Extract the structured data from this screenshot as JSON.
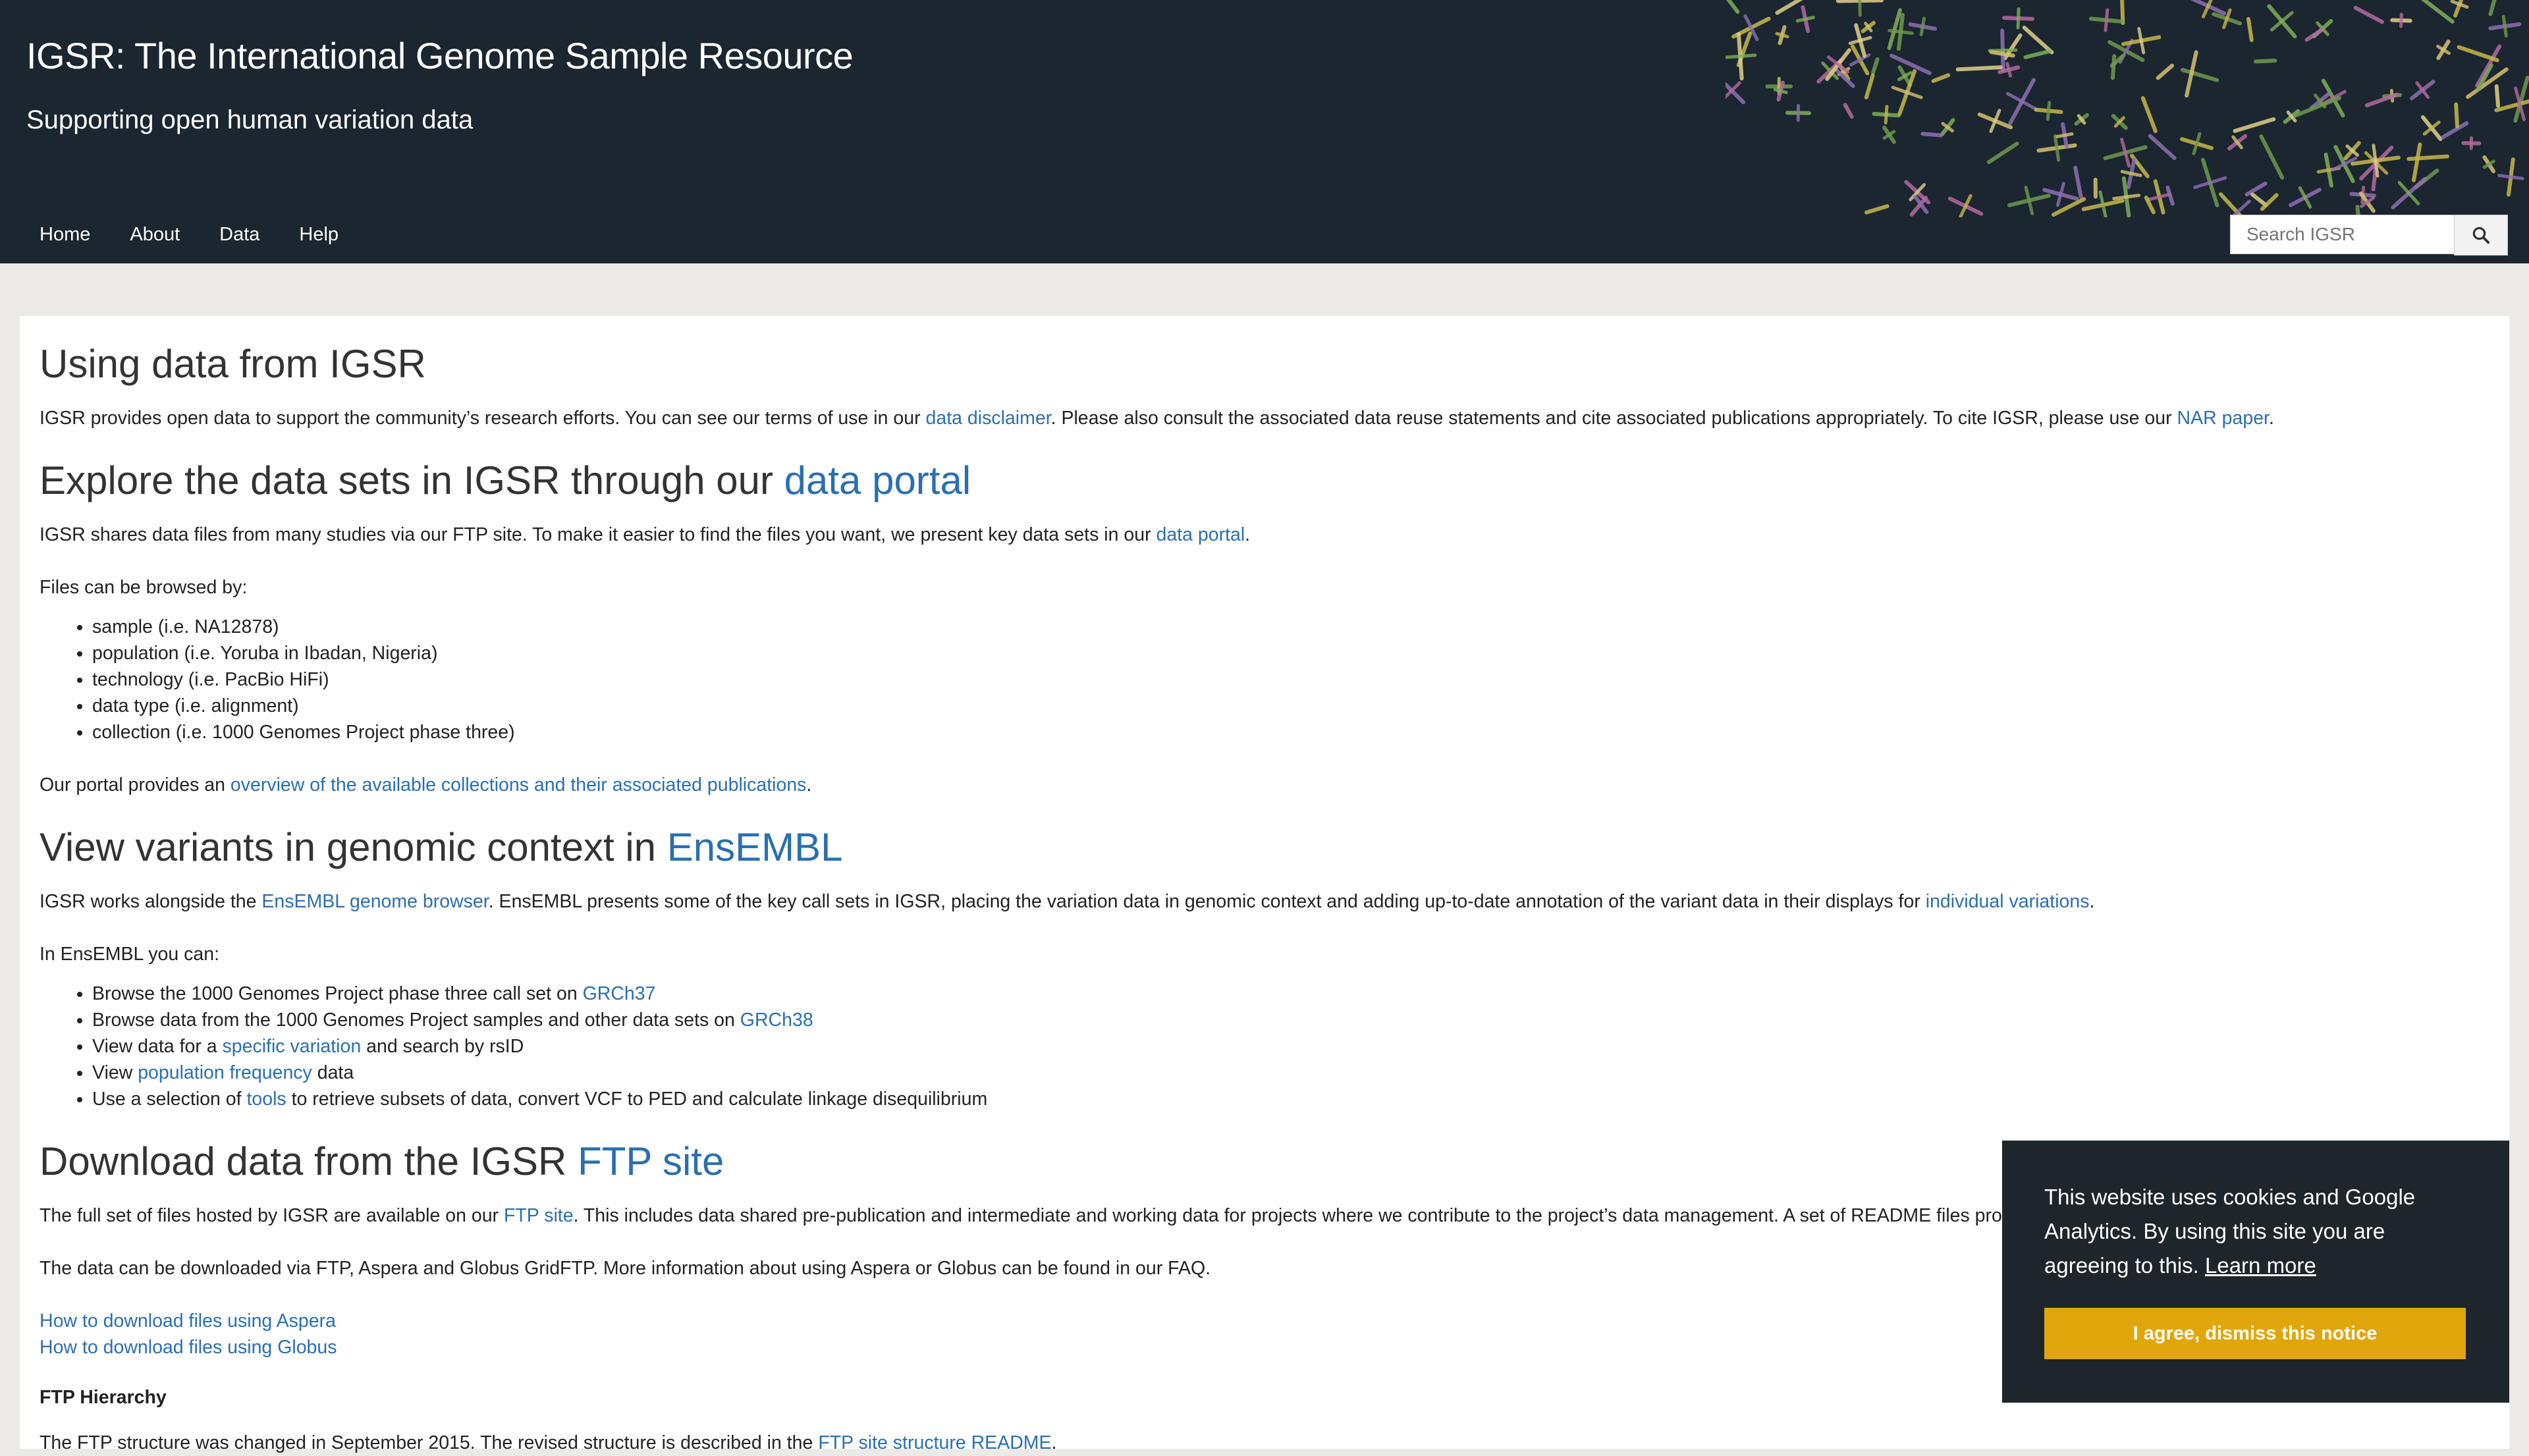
{
  "header": {
    "title": "IGSR: The International Genome Sample Resource",
    "subtitle": "Supporting open human variation data",
    "nav": [
      "Home",
      "About",
      "Data",
      "Help"
    ],
    "search_placeholder": "Search IGSR",
    "bg_color": "#1b2630"
  },
  "intro": {
    "title": "Using data from IGSR",
    "p1_a": "IGSR provides open data to support the community’s research efforts. You can see our terms of use in our ",
    "p1_link1": "data disclaimer",
    "p1_b": ". Please also consult the associated data reuse statements and cite associated publications appropriately. To cite IGSR, please use our ",
    "p1_link2": "NAR paper",
    "p1_c": "."
  },
  "explore": {
    "heading_a": "Explore the data sets in IGSR through our ",
    "heading_link": "data portal",
    "p1_a": "IGSR shares data files from many studies via our FTP site. To make it easier to find the files you want, we present key data sets in our ",
    "p1_link": "data portal",
    "p1_b": ".",
    "p2": "Files can be browsed by:",
    "list": [
      "sample (i.e. NA12878)",
      "population (i.e. Yoruba in Ibadan, Nigeria)",
      "technology (i.e. PacBio HiFi)",
      "data type (i.e. alignment)",
      "collection (i.e. 1000 Genomes Project phase three)"
    ],
    "p3_a": "Our portal provides an ",
    "p3_link": "overview of the available collections and their associated publications",
    "p3_b": "."
  },
  "ensembl": {
    "heading_a": "View variants in genomic context in ",
    "heading_link": "EnsEMBL",
    "p1_a": "IGSR works alongside the ",
    "p1_link1": "EnsEMBL genome browser",
    "p1_b": ". EnsEMBL presents some of the key call sets in IGSR, placing the variation data in genomic context and adding up-to-date annotation of the variant data in their displays for ",
    "p1_link2": "individual variations",
    "p1_c": ".",
    "p2": "In EnsEMBL you can:",
    "li1_a": "Browse the 1000 Genomes Project phase three call set on ",
    "li1_link": "GRCh37",
    "li2_a": "Browse data from the 1000 Genomes Project samples and other data sets on ",
    "li2_link": "GRCh38",
    "li3_a": "View data for a ",
    "li3_link": "specific variation",
    "li3_b": " and search by rsID",
    "li4_a": "View ",
    "li4_link": "population frequency",
    "li4_b": " data",
    "li5_a": "Use a selection of ",
    "li5_link": "tools",
    "li5_b": " to retrieve subsets of data, convert VCF to PED and calculate linkage disequilibrium"
  },
  "download": {
    "heading_a": "Download data from the IGSR ",
    "heading_link": "FTP site",
    "p1_a": "The full set of files hosted by IGSR are available on our ",
    "p1_link": "FTP site",
    "p1_b": ". This includes data shared pre-publication and intermediate and working data for projects where we contribute to the project’s data management. A set of README files provi",
    "p2": "The data can be downloaded via FTP, Aspera and Globus GridFTP. More information about using Aspera or Globus can be found in our FAQ.",
    "link_aspera": "How to download files using Aspera",
    "link_globus": "How to download files using Globus",
    "ftp_heading": "FTP Hierarchy",
    "p3_a": "The FTP structure was changed in September 2015. The revised structure is described in the ",
    "p3_link": "FTP site structure README",
    "p3_b": "."
  },
  "cookie": {
    "text": "This website uses cookies and Google Analytics. By using this site you are agreeing to this.",
    "learn_more": "Learn more",
    "button": "I agree, dismiss this notice",
    "button_color": "#e0a60b"
  },
  "icons": {
    "search": "search-icon"
  }
}
